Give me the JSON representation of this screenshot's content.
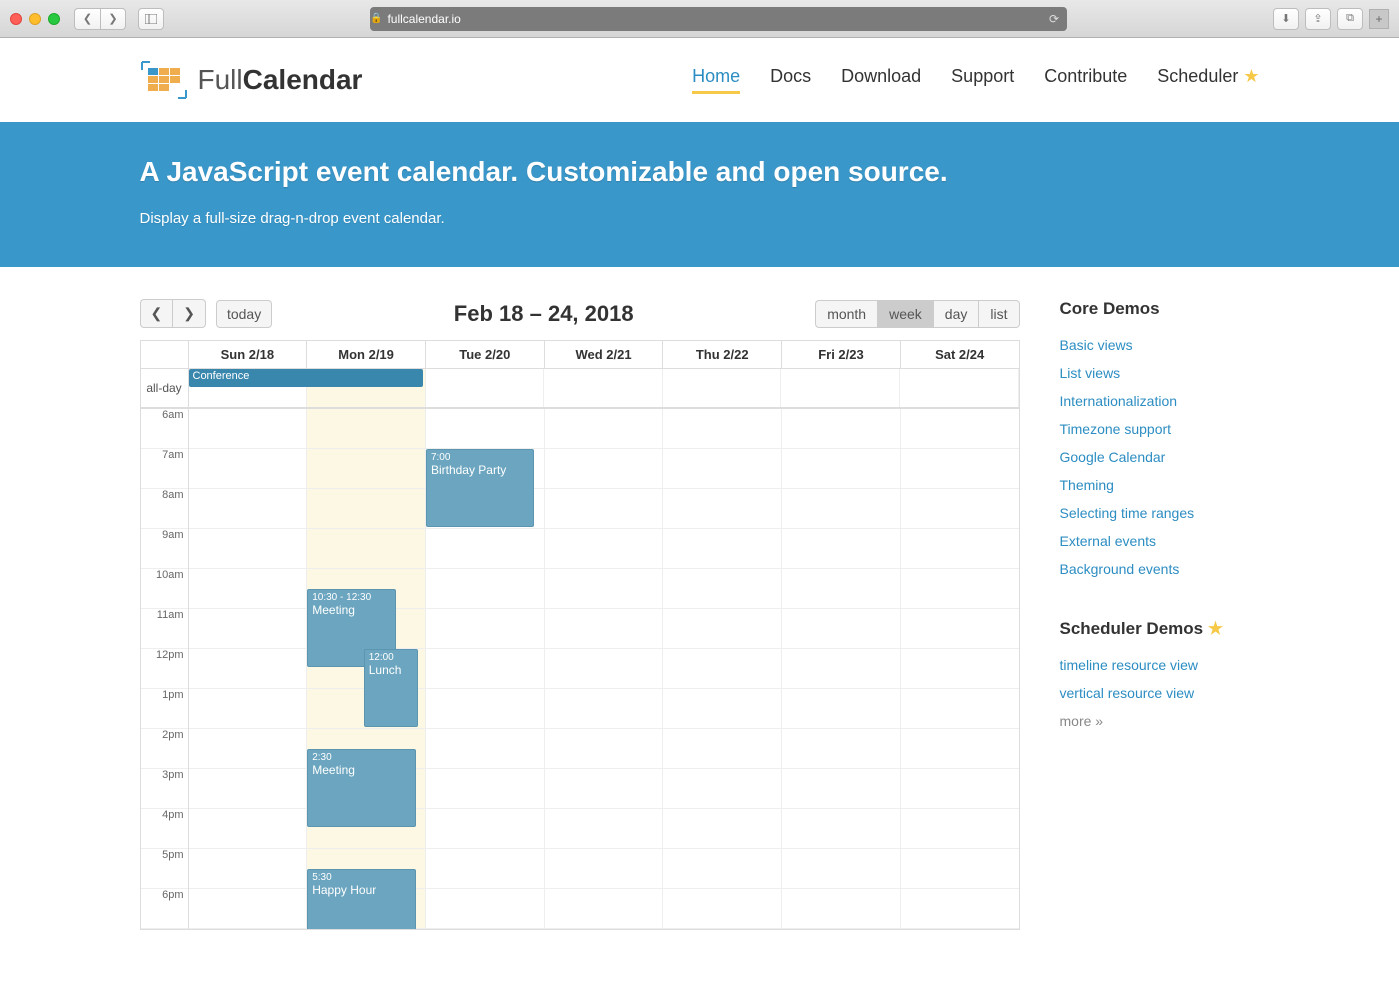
{
  "browser": {
    "url": "fullcalendar.io"
  },
  "logo": {
    "text_light": "Full",
    "text_bold": "Calendar"
  },
  "nav": {
    "home": "Home",
    "docs": "Docs",
    "download": "Download",
    "support": "Support",
    "contribute": "Contribute",
    "scheduler": "Scheduler"
  },
  "hero": {
    "headline": "A JavaScript event calendar. Customizable and open source.",
    "subline": "Display a full-size drag-n-drop event calendar."
  },
  "calendar": {
    "title": "Feb 18 – 24, 2018",
    "today_label": "today",
    "views": {
      "month": "month",
      "week": "week",
      "day": "day",
      "list": "list"
    },
    "active_view": "week",
    "allday_label": "all-day",
    "days": [
      "Sun 2/18",
      "Mon 2/19",
      "Tue 2/20",
      "Wed 2/21",
      "Thu 2/22",
      "Fri 2/23",
      "Sat 2/24"
    ],
    "today_index": 1,
    "hours": [
      "6am",
      "7am",
      "8am",
      "9am",
      "10am",
      "11am",
      "12pm",
      "1pm",
      "2pm",
      "3pm",
      "4pm",
      "5pm",
      "6pm"
    ],
    "allday_events": [
      {
        "title": "Conference",
        "start_col": 0,
        "span": 2
      }
    ],
    "events": [
      {
        "day": 2,
        "time_label": "7:00",
        "title": "Birthday Party",
        "top_hour": 7,
        "duration": 2,
        "left_pct": 0,
        "width_pct": 92
      },
      {
        "day": 1,
        "time_label": "10:30 - 12:30",
        "title": "Meeting",
        "top_hour": 10.5,
        "duration": 2,
        "left_pct": 0,
        "width_pct": 75
      },
      {
        "day": 1,
        "time_label": "12:00",
        "title": "Lunch",
        "top_hour": 12,
        "duration": 2,
        "left_pct": 48,
        "width_pct": 46
      },
      {
        "day": 1,
        "time_label": "2:30",
        "title": "Meeting",
        "top_hour": 14.5,
        "duration": 2,
        "left_pct": 0,
        "width_pct": 92
      },
      {
        "day": 1,
        "time_label": "5:30",
        "title": "Happy Hour",
        "top_hour": 17.5,
        "duration": 2,
        "left_pct": 0,
        "width_pct": 92
      }
    ]
  },
  "sidebar": {
    "core_title": "Core Demos",
    "core_links": [
      "Basic views",
      "List views",
      "Internationalization",
      "Timezone support",
      "Google Calendar",
      "Theming",
      "Selecting time ranges",
      "External events",
      "Background events"
    ],
    "sched_title": "Scheduler Demos",
    "sched_links": [
      "timeline resource view",
      "vertical resource view"
    ],
    "more": "more »"
  }
}
